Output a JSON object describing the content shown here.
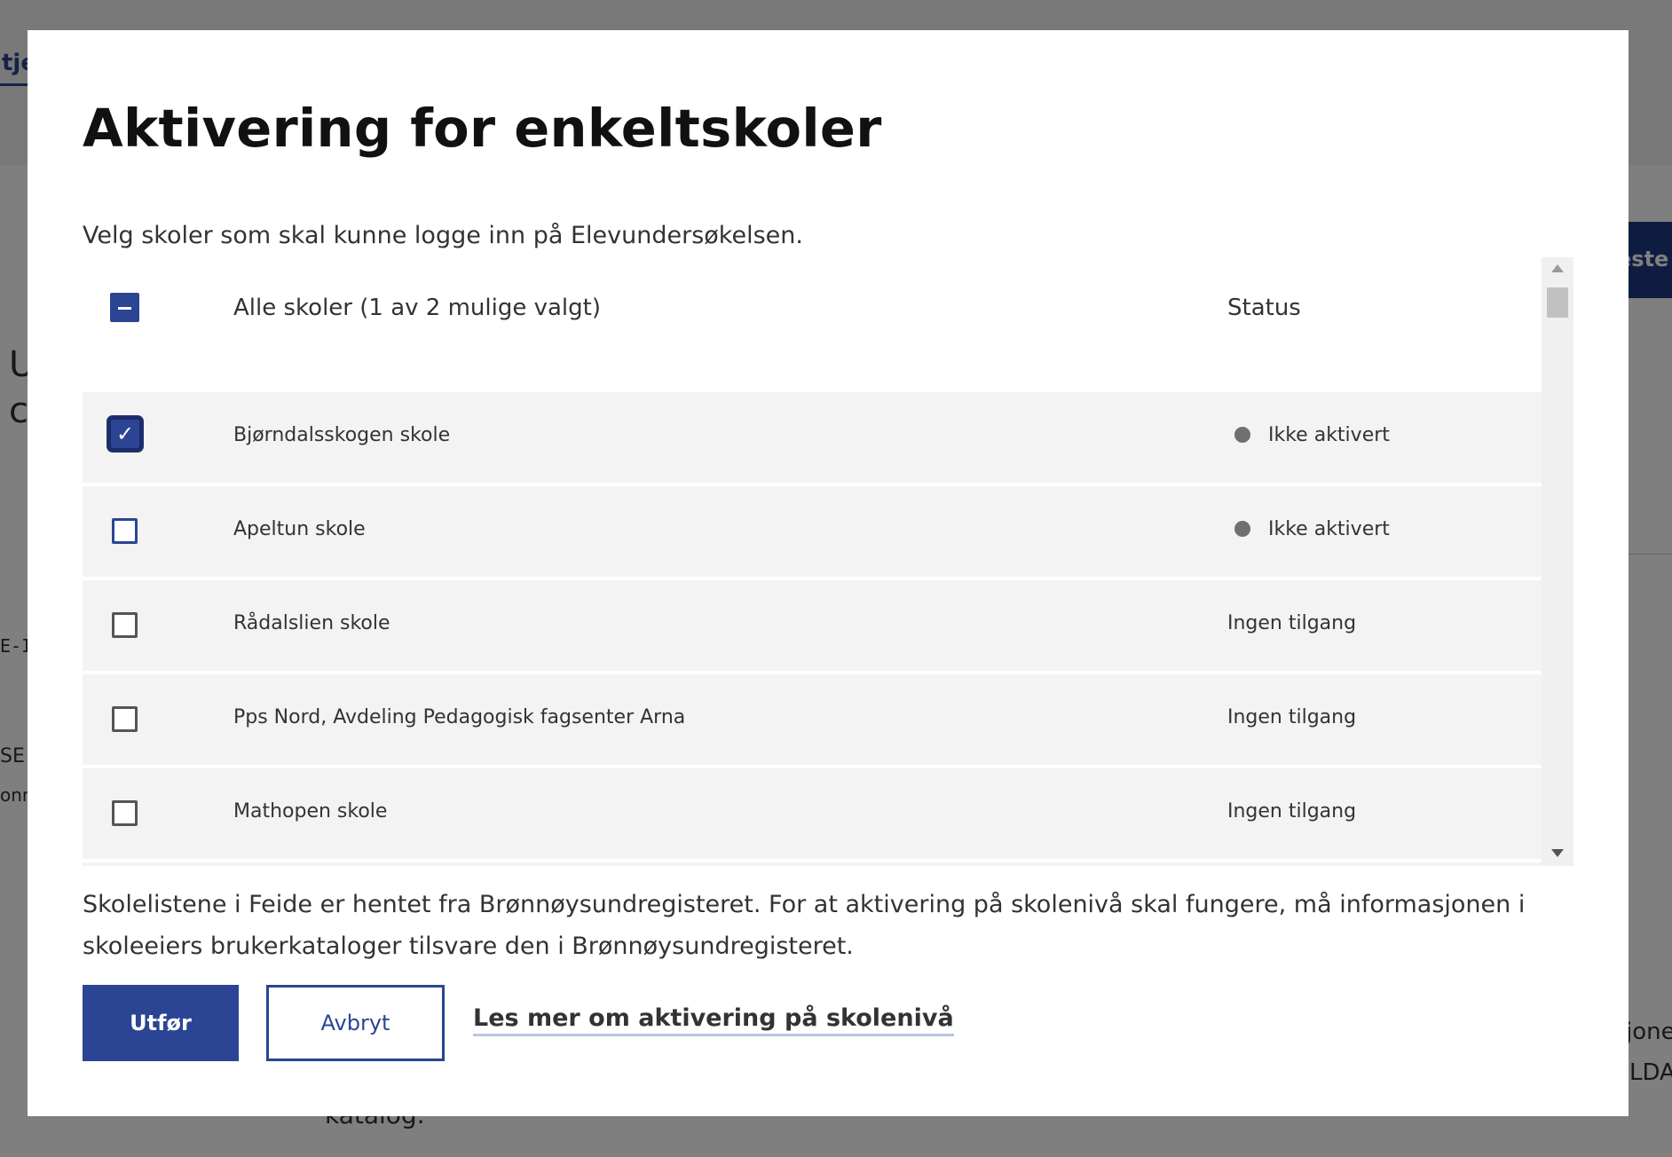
{
  "background": {
    "tab_fragment": "tje",
    "heading_fragment_1": "U",
    "heading_fragment_2": "c",
    "label_fragment_1": "E-I",
    "label_fragment_2": "SE",
    "label_fragment_3": "onr",
    "button_fragment": "este",
    "right_text_1": "jone",
    "right_text_2": "LDA",
    "bottom_text": "katalog."
  },
  "modal": {
    "title": "Aktivering for enkeltskoler",
    "intro": "Velg skoler som skal kunne logge inn på Elevundersøkelsen.",
    "table": {
      "header_label": "Alle skoler (1 av 2 mulige valgt)",
      "status_header": "Status",
      "rows": [
        {
          "name": "Bjørndalsskogen skole",
          "status": "Ikke aktivert",
          "checked": true
        },
        {
          "name": "Apeltun skole",
          "status": "Ikke aktivert",
          "checked": false
        },
        {
          "name": "Rådalslien skole",
          "status": "Ingen tilgang",
          "checked": false
        },
        {
          "name": "Pps Nord, Avdeling Pedagogisk fagsenter Arna",
          "status": "Ingen tilgang",
          "checked": false
        },
        {
          "name": "Mathopen skole",
          "status": "Ingen tilgang",
          "checked": false
        }
      ]
    },
    "info_text": "Skolelistene i Feide er hentet fra Brønnøysundregisteret. For at aktivering på skolenivå skal fungere, må informasjonen i skoleeiers brukerkataloger tilsvare den i Brønnøysundregisteret.",
    "primary_button": "Utfør",
    "secondary_button": "Avbryt",
    "link_text": "Les mer om aktivering på skolenivå"
  },
  "colors": {
    "accent": "#2b4594",
    "overlay": "rgba(0,0,0,0.5)",
    "status_dot": "#707070",
    "row_background": "#f3f3f3"
  }
}
